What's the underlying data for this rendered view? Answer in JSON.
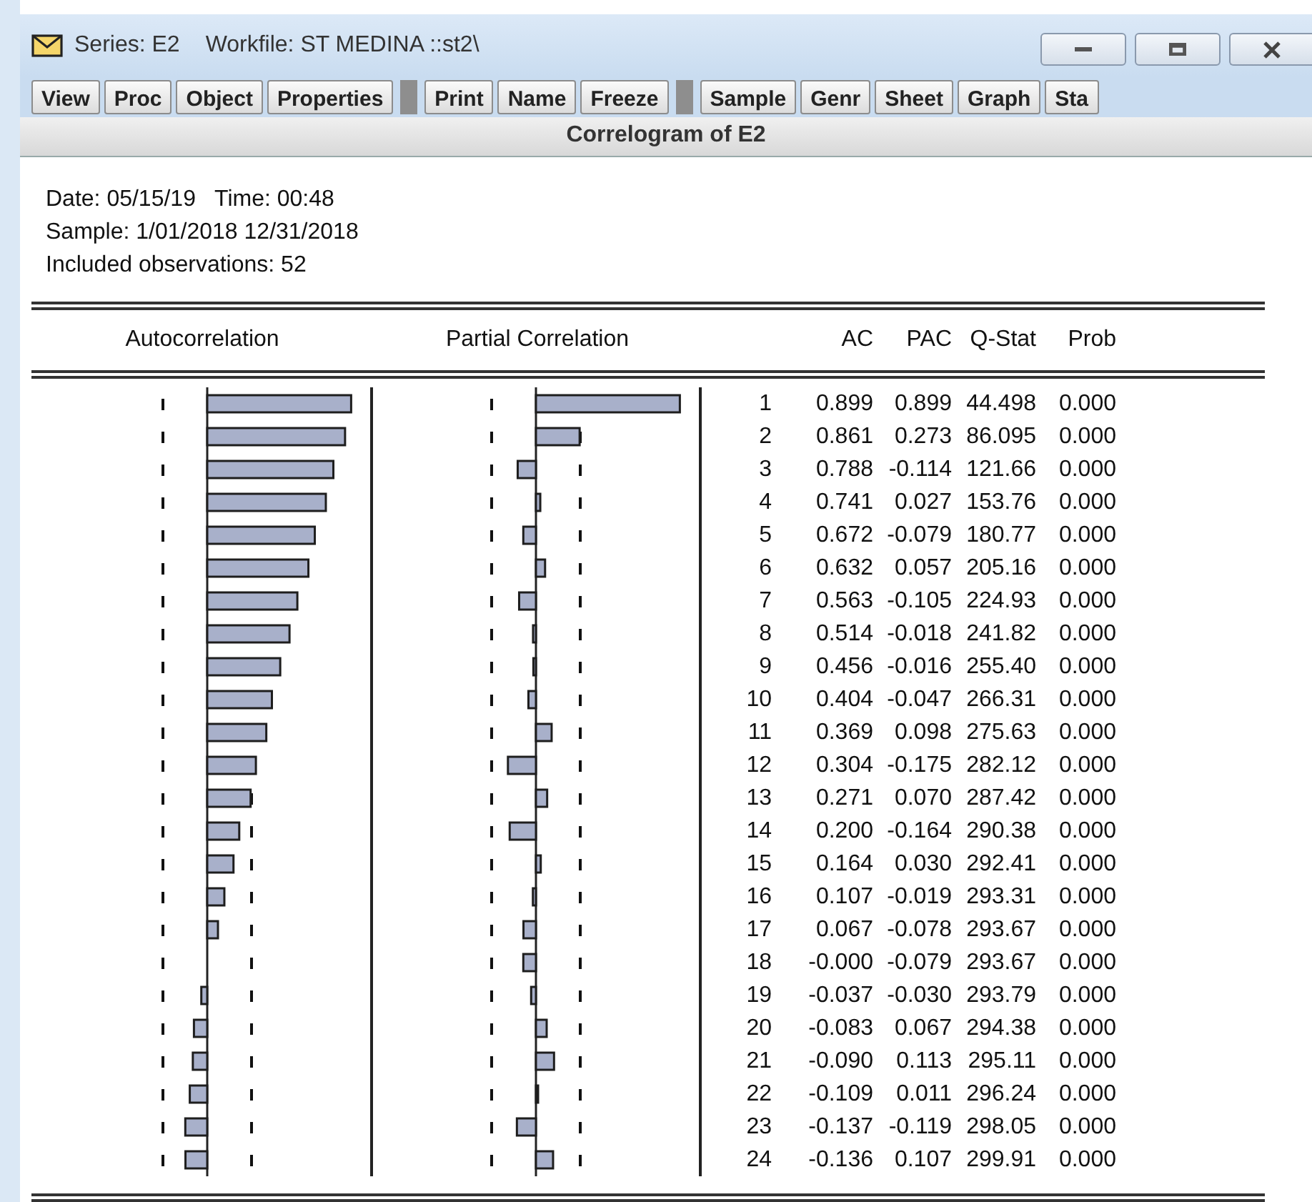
{
  "window": {
    "title_parts": [
      "Series: E2",
      "Workfile: ST MEDINA ::st2\\"
    ]
  },
  "toolbar": [
    [
      "View",
      "Proc",
      "Object",
      "Properties"
    ],
    [
      "Print",
      "Name",
      "Freeze"
    ],
    [
      "Sample",
      "Genr",
      "Sheet",
      "Graph",
      "Sta"
    ]
  ],
  "view_title": "Correlogram of E2",
  "info_lines": [
    "Date: 05/15/19   Time: 00:48",
    "Sample: 1/01/2018 12/31/2018",
    "Included observations: 52"
  ],
  "columns": [
    "Autocorrelation",
    "Partial Correlation",
    "AC",
    "PAC",
    "Q-Stat",
    "Prob"
  ],
  "rows": [
    {
      "lag": "1",
      "ac": "0.899",
      "pac": "0.899",
      "q_stat": "44.498",
      "prob": "0.000"
    },
    {
      "lag": "2",
      "ac": "0.861",
      "pac": "0.273",
      "q_stat": "86.095",
      "prob": "0.000"
    },
    {
      "lag": "3",
      "ac": "0.788",
      "pac": "-0.114",
      "q_stat": "121.66",
      "prob": "0.000"
    },
    {
      "lag": "4",
      "ac": "0.741",
      "pac": "0.027",
      "q_stat": "153.76",
      "prob": "0.000"
    },
    {
      "lag": "5",
      "ac": "0.672",
      "pac": "-0.079",
      "q_stat": "180.77",
      "prob": "0.000"
    },
    {
      "lag": "6",
      "ac": "0.632",
      "pac": "0.057",
      "q_stat": "205.16",
      "prob": "0.000"
    },
    {
      "lag": "7",
      "ac": "0.563",
      "pac": "-0.105",
      "q_stat": "224.93",
      "prob": "0.000"
    },
    {
      "lag": "8",
      "ac": "0.514",
      "pac": "-0.018",
      "q_stat": "241.82",
      "prob": "0.000"
    },
    {
      "lag": "9",
      "ac": "0.456",
      "pac": "-0.016",
      "q_stat": "255.40",
      "prob": "0.000"
    },
    {
      "lag": "10",
      "ac": "0.404",
      "pac": "-0.047",
      "q_stat": "266.31",
      "prob": "0.000"
    },
    {
      "lag": "11",
      "ac": "0.369",
      "pac": "0.098",
      "q_stat": "275.63",
      "prob": "0.000"
    },
    {
      "lag": "12",
      "ac": "0.304",
      "pac": "-0.175",
      "q_stat": "282.12",
      "prob": "0.000"
    },
    {
      "lag": "13",
      "ac": "0.271",
      "pac": "0.070",
      "q_stat": "287.42",
      "prob": "0.000"
    },
    {
      "lag": "14",
      "ac": "0.200",
      "pac": "-0.164",
      "q_stat": "290.38",
      "prob": "0.000"
    },
    {
      "lag": "15",
      "ac": "0.164",
      "pac": "0.030",
      "q_stat": "292.41",
      "prob": "0.000"
    },
    {
      "lag": "16",
      "ac": "0.107",
      "pac": "-0.019",
      "q_stat": "293.31",
      "prob": "0.000"
    },
    {
      "lag": "17",
      "ac": "0.067",
      "pac": "-0.078",
      "q_stat": "293.67",
      "prob": "0.000"
    },
    {
      "lag": "18",
      "ac": "-0.000",
      "pac": "-0.079",
      "q_stat": "293.67",
      "prob": "0.000"
    },
    {
      "lag": "19",
      "ac": "-0.037",
      "pac": "-0.030",
      "q_stat": "293.79",
      "prob": "0.000"
    },
    {
      "lag": "20",
      "ac": "-0.083",
      "pac": "0.067",
      "q_stat": "294.38",
      "prob": "0.000"
    },
    {
      "lag": "21",
      "ac": "-0.090",
      "pac": "0.113",
      "q_stat": "295.11",
      "prob": "0.000"
    },
    {
      "lag": "22",
      "ac": "-0.109",
      "pac": "0.011",
      "q_stat": "296.24",
      "prob": "0.000"
    },
    {
      "lag": "23",
      "ac": "-0.137",
      "pac": "-0.119",
      "q_stat": "298.05",
      "prob": "0.000"
    },
    {
      "lag": "24",
      "ac": "-0.136",
      "pac": "0.107",
      "q_stat": "299.91",
      "prob": "0.000"
    }
  ]
}
